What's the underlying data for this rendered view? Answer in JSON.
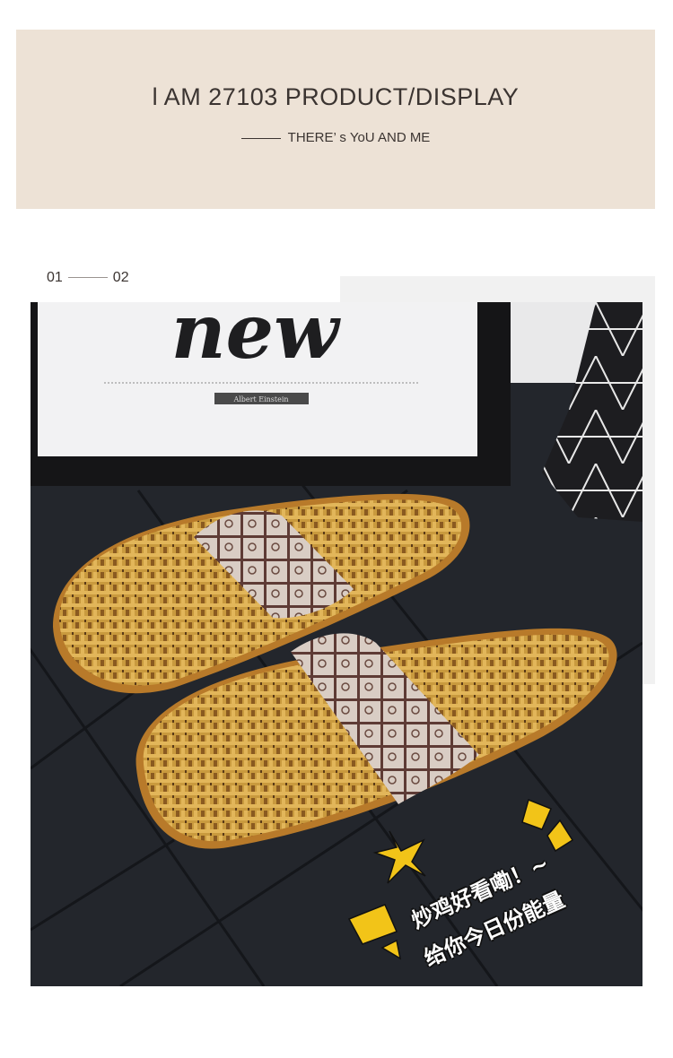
{
  "banner": {
    "title": "l AM 27103 PRODUCT/DISPLAY",
    "subtitle": "THERE’ s YoU AND ME"
  },
  "index": {
    "current": "01",
    "next": "02"
  },
  "photo": {
    "sign_text": "new",
    "sign_tag": "Albert Einstein",
    "overlay_line1": "炒鸡好看嘞！~",
    "overlay_line2": "给你今日份能量",
    "accent_color": "#f2c418"
  }
}
